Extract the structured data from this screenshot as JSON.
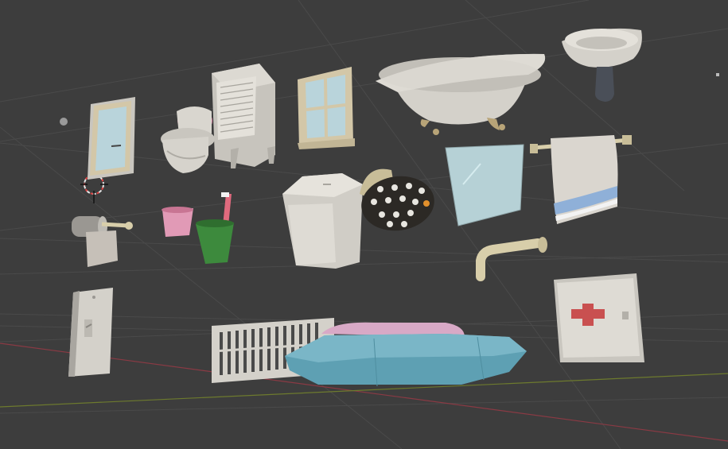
{
  "app": {
    "name": "3D Viewport",
    "view": "perspective"
  },
  "scene": {
    "background": "#3d3d3d",
    "grid_color": "#4a4a4a",
    "x_axis_color": "#8a3a44",
    "y_axis_color": "#6d7a2e",
    "objects": [
      "door",
      "toilet",
      "cabinet",
      "window",
      "bathtub",
      "sink",
      "toilet-paper-holder",
      "pink-cup",
      "toothbrush-cup",
      "trash-can",
      "shower-head",
      "mirror",
      "towel-rack",
      "faucet",
      "light-switch",
      "air-vent",
      "soap-bar",
      "first-aid-cabinet"
    ],
    "colors": {
      "porcelain": "#c9c6bf",
      "wood_frame": "#d3c7a8",
      "glass": "#b9d4db",
      "pink": "#d77fa0",
      "green": "#3d8a3d",
      "soap_blue": "#5ea0b3",
      "soap_pink": "#d8a9c6",
      "cross_red": "#c95050",
      "towel_stripe": "#8fb0d8"
    }
  },
  "ui": {
    "origin_marker": "3d-cursor",
    "light": "point-light"
  }
}
